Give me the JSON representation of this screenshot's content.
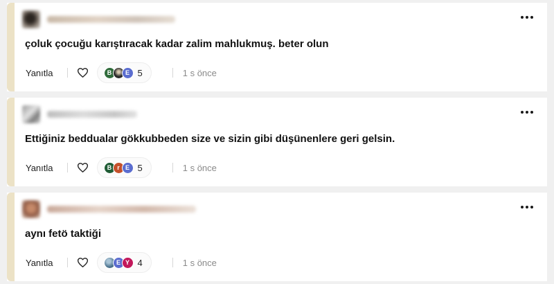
{
  "colors": {
    "accent_bar": "#ece2c6",
    "background": "#f0f0f0",
    "card": "#ffffff",
    "muted_text": "#8a8a8a"
  },
  "comments": [
    {
      "text": "çoluk çocuğu karıştıracak kadar zalim mahlukmuş. beter olun",
      "reply_label": "Yanıtla",
      "reaction_count": "5",
      "time": "1 s önce",
      "more_icon": "more-horizontal-icon",
      "like_icon": "heart-icon",
      "reactions": [
        {
          "letter": "B",
          "color": "#2f6b3a"
        },
        {
          "letter": "",
          "color": "#2a2a2a"
        },
        {
          "letter": "E",
          "color": "#5b6dcf"
        }
      ]
    },
    {
      "text": "Ettiğiniz beddualar gökkubbeden size ve sizin gibi düşünenlere geri gelsin.",
      "reply_label": "Yanıtla",
      "reaction_count": "5",
      "time": "1 s önce",
      "more_icon": "more-horizontal-icon",
      "like_icon": "heart-icon",
      "reactions": [
        {
          "letter": "B",
          "color": "#1f5c35"
        },
        {
          "letter": "r",
          "color": "#c4502b"
        },
        {
          "letter": "E",
          "color": "#5b6dcf"
        }
      ]
    },
    {
      "text": "aynı fetö taktiği",
      "reply_label": "Yanıtla",
      "reaction_count": "4",
      "time": "1 s önce",
      "more_icon": "more-horizontal-icon",
      "like_icon": "heart-icon",
      "reactions": [
        {
          "letter": "",
          "color": "#6a8fa8"
        },
        {
          "letter": "E",
          "color": "#5b6dcf"
        },
        {
          "letter": "Y",
          "color": "#c2185b"
        }
      ]
    }
  ]
}
